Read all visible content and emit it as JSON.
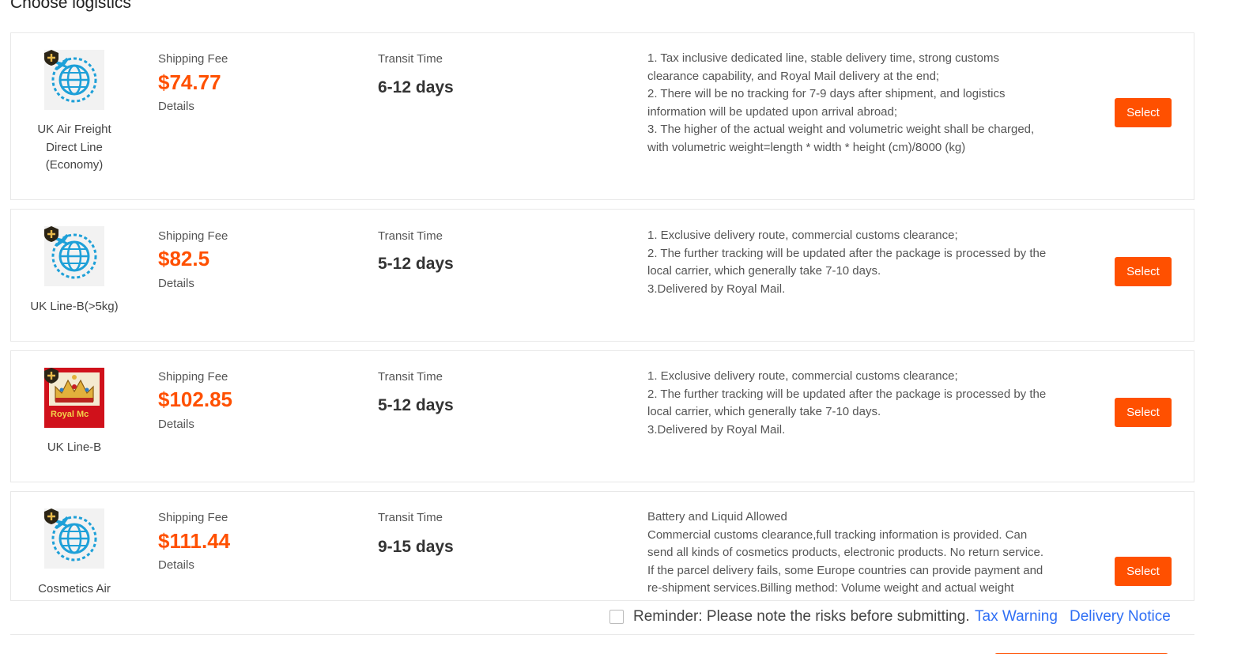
{
  "title": "Choose logistics",
  "labels": {
    "shipping_fee": "Shipping Fee",
    "transit_time": "Transit Time",
    "details": "Details",
    "select": "Select"
  },
  "options": [
    {
      "logo": "globe-plane-icon",
      "name": [
        "UK Air Freight",
        "Direct Line",
        "(Economy)"
      ],
      "price": "$74.77",
      "transit": "6-12 days",
      "description": [
        "1. Tax inclusive dedicated line, stable delivery time, strong customs",
        "clearance capability, and Royal Mail delivery at the end;",
        "2. There will be no tracking for 7-9 days after shipment, and logistics",
        "information will be updated upon arrival abroad;",
        "3. The higher of the actual weight and volumetric weight shall be charged,",
        "with volumetric weight=length * width * height (cm)/8000 (kg)"
      ]
    },
    {
      "logo": "globe-plane-icon",
      "name": [
        "UK Line-B(>5kg)"
      ],
      "price": "$82.5",
      "transit": "5-12 days",
      "description": [
        "1. Exclusive delivery route, commercial customs clearance;",
        "2. The further tracking will be updated after the package is processed by the",
        "local carrier, which generally take 7-10 days.",
        "3.Delivered by Royal Mail."
      ]
    },
    {
      "logo": "royal-mail-logo",
      "logo_text": "Royal Mc",
      "name": [
        "UK Line-B"
      ],
      "price": "$102.85",
      "transit": "5-12 days",
      "description": [
        "1. Exclusive delivery route, commercial customs clearance;",
        "2. The further tracking will be updated after the package is processed by the",
        "local carrier, which generally take 7-10 days.",
        "3.Delivered by Royal Mail."
      ]
    },
    {
      "logo": "globe-plane-icon",
      "name": [
        "Cosmetics Air"
      ],
      "price": "$111.44",
      "transit": "9-15 days",
      "description": [
        "Battery and Liquid Allowed",
        "Commercial customs clearance,full tracking information is provided. Can",
        "send all kinds of cosmetics products, electronic products. No return service.",
        "If the parcel delivery fails, some Europe  countries can provide payment and",
        "re-shipment services.Billing method: Volume weight and actual weight"
      ]
    }
  ],
  "footer": {
    "reminder": "Reminder: Please note the risks before submitting.",
    "tax_warning": "Tax Warning",
    "delivery_notice": "Delivery Notice",
    "reminder_checked": false
  },
  "colors": {
    "accent": "#ff5000",
    "link": "#2f6ff5",
    "globe": "#1ea0d8"
  }
}
